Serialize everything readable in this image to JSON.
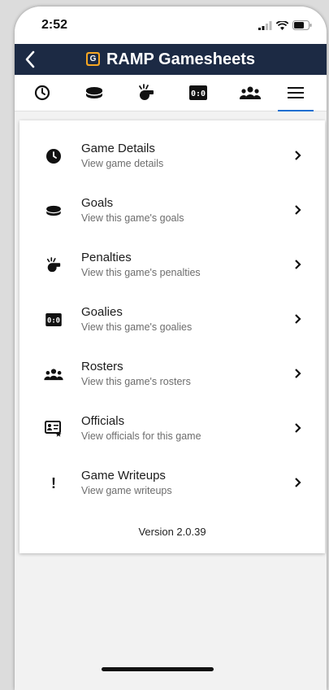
{
  "status": {
    "time": "2:52"
  },
  "header": {
    "title": "RAMP Gamesheets",
    "logo_letter": "G"
  },
  "tabs": [
    {
      "icon": "clock-icon"
    },
    {
      "icon": "puck-icon"
    },
    {
      "icon": "whistle-icon"
    },
    {
      "icon": "scoreboard-icon",
      "label": "0:0"
    },
    {
      "icon": "team-icon"
    },
    {
      "icon": "menu-icon",
      "active": true
    }
  ],
  "menu": [
    {
      "title": "Game Details",
      "subtitle": "View game details",
      "icon": "clock-icon"
    },
    {
      "title": "Goals",
      "subtitle": "View this game's goals",
      "icon": "puck-icon"
    },
    {
      "title": "Penalties",
      "subtitle": "View this game's penalties",
      "icon": "whistle-icon"
    },
    {
      "title": "Goalies",
      "subtitle": "View this game's goalies",
      "icon": "scoreboard-icon",
      "icon_label": "0:0"
    },
    {
      "title": "Rosters",
      "subtitle": "View this game's rosters",
      "icon": "team-icon"
    },
    {
      "title": "Officials",
      "subtitle": "View officials for this game",
      "icon": "official-badge-icon"
    },
    {
      "title": "Game Writeups",
      "subtitle": "View game writeups",
      "icon": "exclamation-icon",
      "icon_label": "!"
    }
  ],
  "footer": {
    "version": "Version 2.0.39"
  },
  "colors": {
    "navbar": "#1c2a44",
    "accent": "#1c6fd1",
    "logo": "#f5a623"
  }
}
